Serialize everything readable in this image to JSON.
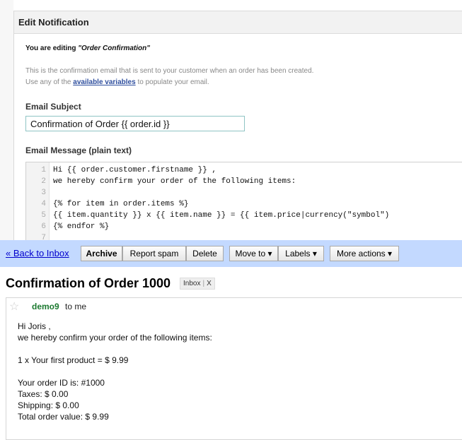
{
  "panel": {
    "title": "Edit Notification",
    "editing_prefix": "You are editing ",
    "editing_name": "\"Order Confirmation\"",
    "desc_line1": "This is the confirmation email that is sent to your customer when an order has been created.",
    "desc_line2_pre": "Use any of the ",
    "desc_link": "available variables",
    "desc_line2_post": " to populate your email.",
    "subject_label": "Email Subject",
    "subject_value": "Confirmation of Order {{ order.id }}",
    "message_label": "Email Message (plain text)",
    "code_lines": [
      {
        "n": "1",
        "text": "Hi {{ order.customer.firstname }} ,"
      },
      {
        "n": "2",
        "text": "we hereby confirm your order of the following items:"
      },
      {
        "n": "3",
        "text": ""
      },
      {
        "n": "4",
        "text": "{% for item in order.items %}"
      },
      {
        "n": "5",
        "text": "{{ item.quantity }} x {{ item.name }} = {{ item.price|currency(\"symbol\")"
      },
      {
        "n": "6",
        "text": "{% endfor %}"
      },
      {
        "n": "7",
        "text": ""
      }
    ]
  },
  "toolbar": {
    "back": "« Back to Inbox",
    "archive": "Archive",
    "report_spam": "Report spam",
    "delete": "Delete",
    "move_to": "Move to ▾",
    "labels": "Labels ▾",
    "more_actions": "More actions ▾"
  },
  "message": {
    "subject": "Confirmation of Order 1000",
    "label": "Inbox",
    "label_remove": "X",
    "sender": "demo9",
    "to": "to me",
    "lines": [
      "Hi Joris ,",
      "we hereby confirm your order of the following items:",
      "1 x Your first product = $ 9.99",
      "Your order ID is: #1000",
      "Taxes: $ 0.00",
      "Shipping: $ 0.00",
      "Total order value: $ 9.99"
    ]
  }
}
